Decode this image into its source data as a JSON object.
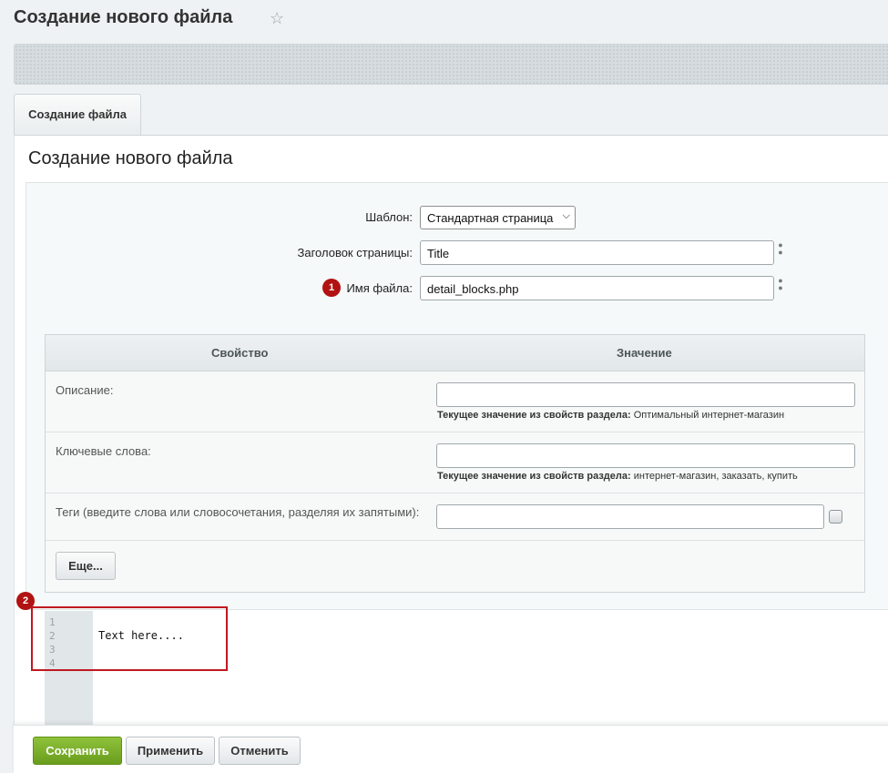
{
  "header": {
    "title": "Создание нового файла",
    "star_icon": "☆"
  },
  "tabs": [
    {
      "label": "Создание файла"
    }
  ],
  "form": {
    "title": "Создание нового файла",
    "template_label": "Шаблон:",
    "template_value": "Стандартная страница",
    "page_title_label": "Заголовок страницы:",
    "page_title_value": "Title",
    "filename_label": "Имя файла:",
    "filename_value": "detail_blocks.php",
    "badge1": "1"
  },
  "properties": {
    "col_property": "Свойство",
    "col_value": "Значение",
    "rows": [
      {
        "label": "Описание:",
        "hint_prefix": "Текущее значение из свойств раздела:",
        "hint_value": "Оптимальный интернет-магазин"
      },
      {
        "label": "Ключевые слова:",
        "hint_prefix": "Текущее значение из свойств раздела:",
        "hint_value": "интернет-магазин, заказать, купить"
      },
      {
        "label": "Теги (введите слова или словосочетания, разделяя их запятыми):"
      }
    ],
    "more_button": "Еще..."
  },
  "editor": {
    "badge2": "2",
    "line_numbers": [
      "1",
      "2",
      "3",
      "4"
    ],
    "code_text": "Text here...."
  },
  "footer": {
    "save": "Сохранить",
    "apply": "Применить",
    "cancel": "Отменить"
  },
  "colors": {
    "save_green": "#7bb02a",
    "badge_red": "#b11212",
    "highlight_red": "#c0181f"
  }
}
